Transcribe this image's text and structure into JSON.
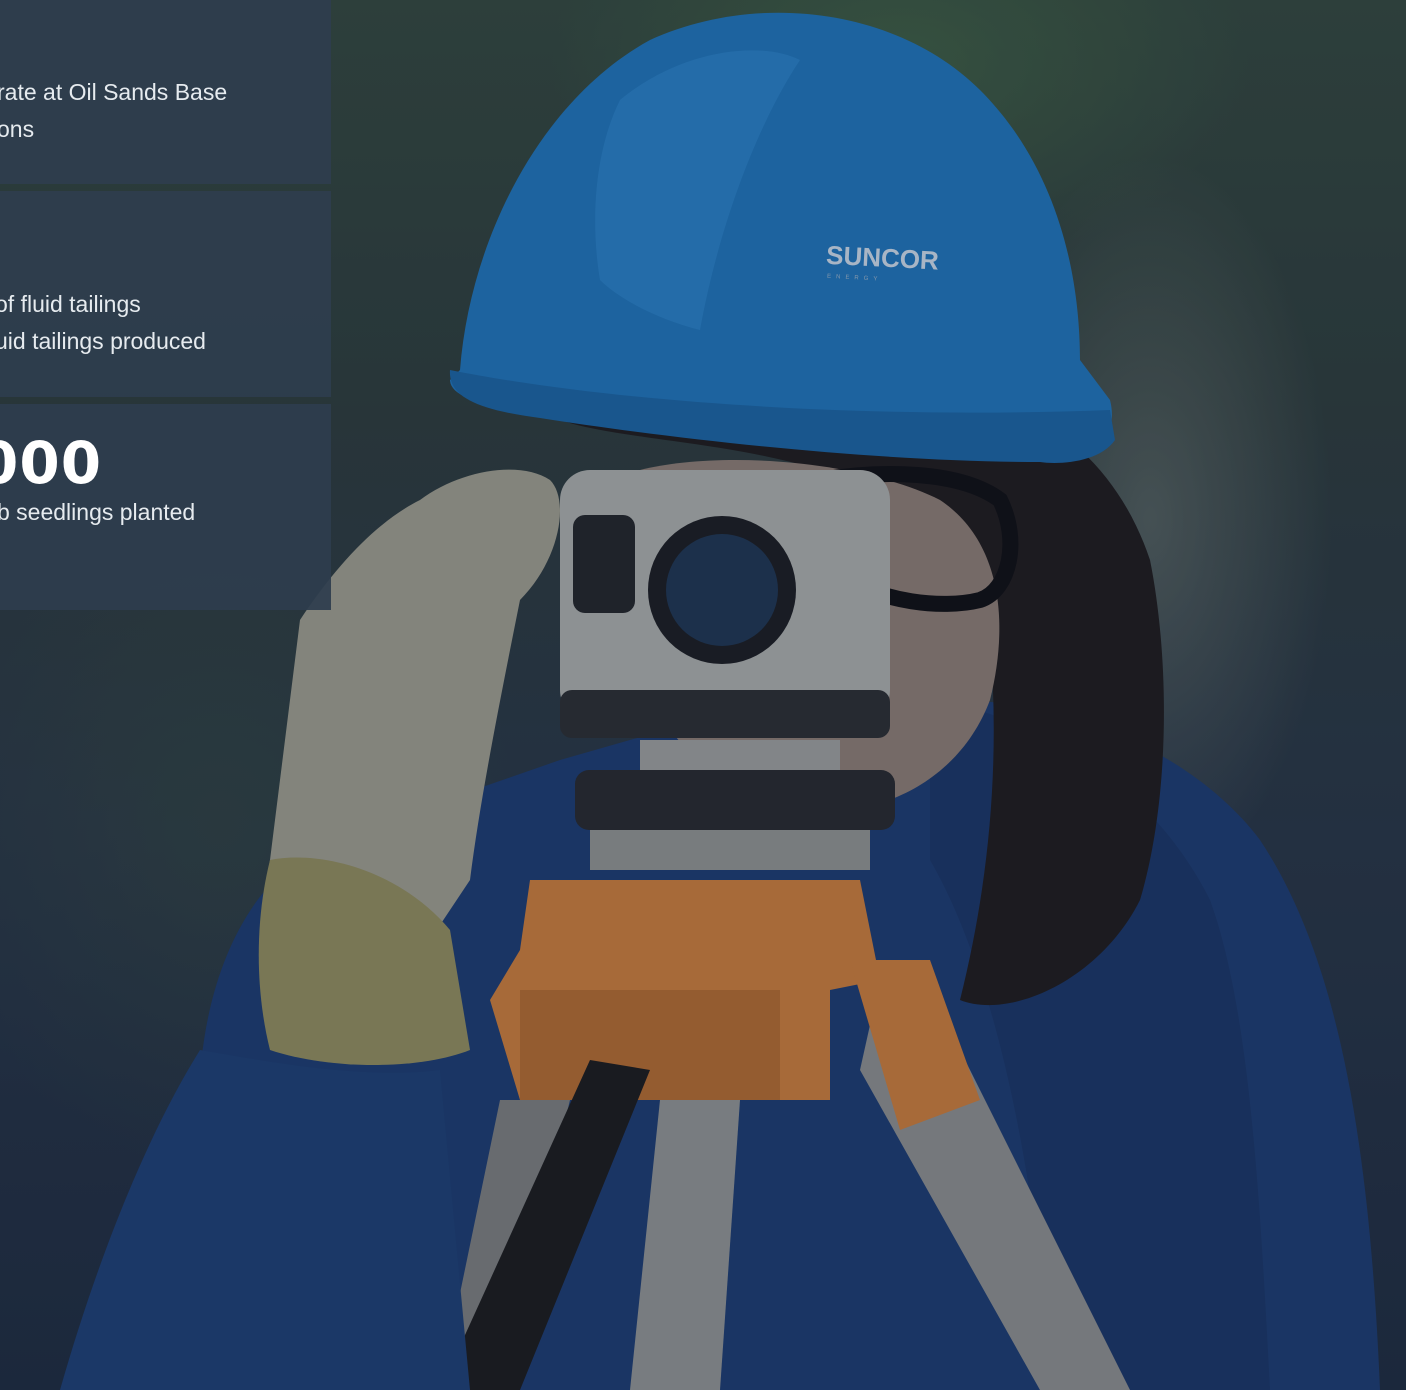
{
  "hero": {
    "helmet_logo": "SUNCOR",
    "helmet_logo_sub": "ENERGY"
  },
  "stats": [
    {
      "value": "",
      "lines": [
        "rate at Oil Sands Base",
        "ons"
      ]
    },
    {
      "value": "",
      "lines": [
        "of fluid tailings",
        "uid tailings produced"
      ]
    },
    {
      "value": "000",
      "lines": [
        "b seedlings planted"
      ]
    }
  ],
  "colors": {
    "card_background": "#2e3d4e",
    "card_text": "#e6ebef",
    "helmet": "#1f74b8",
    "overlay": "#142037"
  }
}
